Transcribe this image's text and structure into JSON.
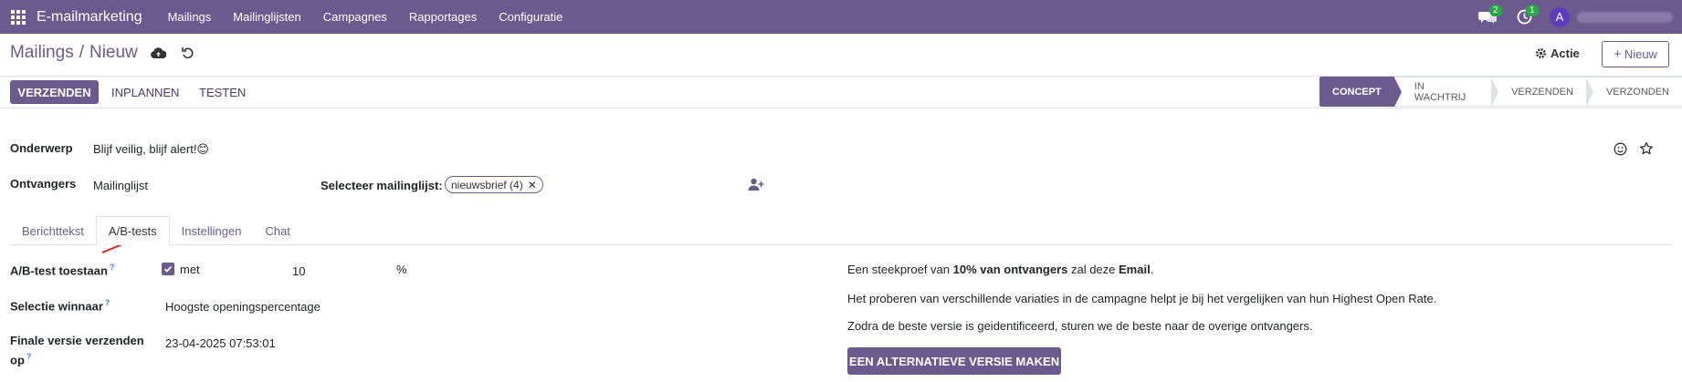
{
  "navbar": {
    "app_name": "E-mailmarketing",
    "menu": [
      "Mailings",
      "Mailinglijsten",
      "Campagnes",
      "Rapportages",
      "Configuratie"
    ],
    "messages_count": "2",
    "activities_count": "1",
    "avatar_letter": "A",
    "bg_color": "#6b5a8e"
  },
  "control": {
    "breadcrumb_parent": "Mailings",
    "breadcrumb_sep": "/",
    "breadcrumb_current": "Nieuw",
    "action_label": "Actie",
    "new_label": "Nieuw"
  },
  "statusbar": {
    "buttons": [
      "VERZENDEN",
      "INPLANNEN",
      "TESTEN"
    ],
    "stages": [
      "CONCEPT",
      "IN WACHTRIJ",
      "VERZENDEN",
      "VERZONDEN"
    ],
    "active_stage": "CONCEPT"
  },
  "form": {
    "subject_label": "Onderwerp",
    "subject_value": "Blijf veilig, blijf alert!😊",
    "recipients_label": "Ontvangers",
    "recipients_value": "Mailinglijst",
    "select_list_label": "Selecteer mailinglijst:",
    "list_tag": "nieuwsbrief (4)"
  },
  "tabs": [
    "Berichttekst",
    "A/B-tests",
    "Instellingen",
    "Chat"
  ],
  "active_tab": "A/B-tests",
  "ab_test": {
    "allow_label": "A/B-test toestaan",
    "allow_checked": true,
    "with_label": "met",
    "percentage_value": "10",
    "percent_sign": "%",
    "winner_label": "Selectie winnaar",
    "winner_value": "Hoogste openingspercentage",
    "final_send_label_1": "Finale versie verzenden",
    "final_send_label_2": "op",
    "final_send_value": "23-04-2025 07:53:01",
    "help_marker": "?",
    "info_line1_pre": "Een steekproef van ",
    "info_line1_bold1": "10% van ontvangers",
    "info_line1_mid": " zal deze ",
    "info_line1_bold2": "Email",
    "info_line1_post": ".",
    "info_line2": "Het proberen van verschillende variaties in de campagne helpt je bij het vergelijken van hun Highest Open Rate.",
    "info_line3": "Zodra de beste versie is geidentificeerd, sturen we de beste naar de overige ontvangers.",
    "alt_version_button": "EEN ALTERNATIEVE VERSIE MAKEN"
  }
}
